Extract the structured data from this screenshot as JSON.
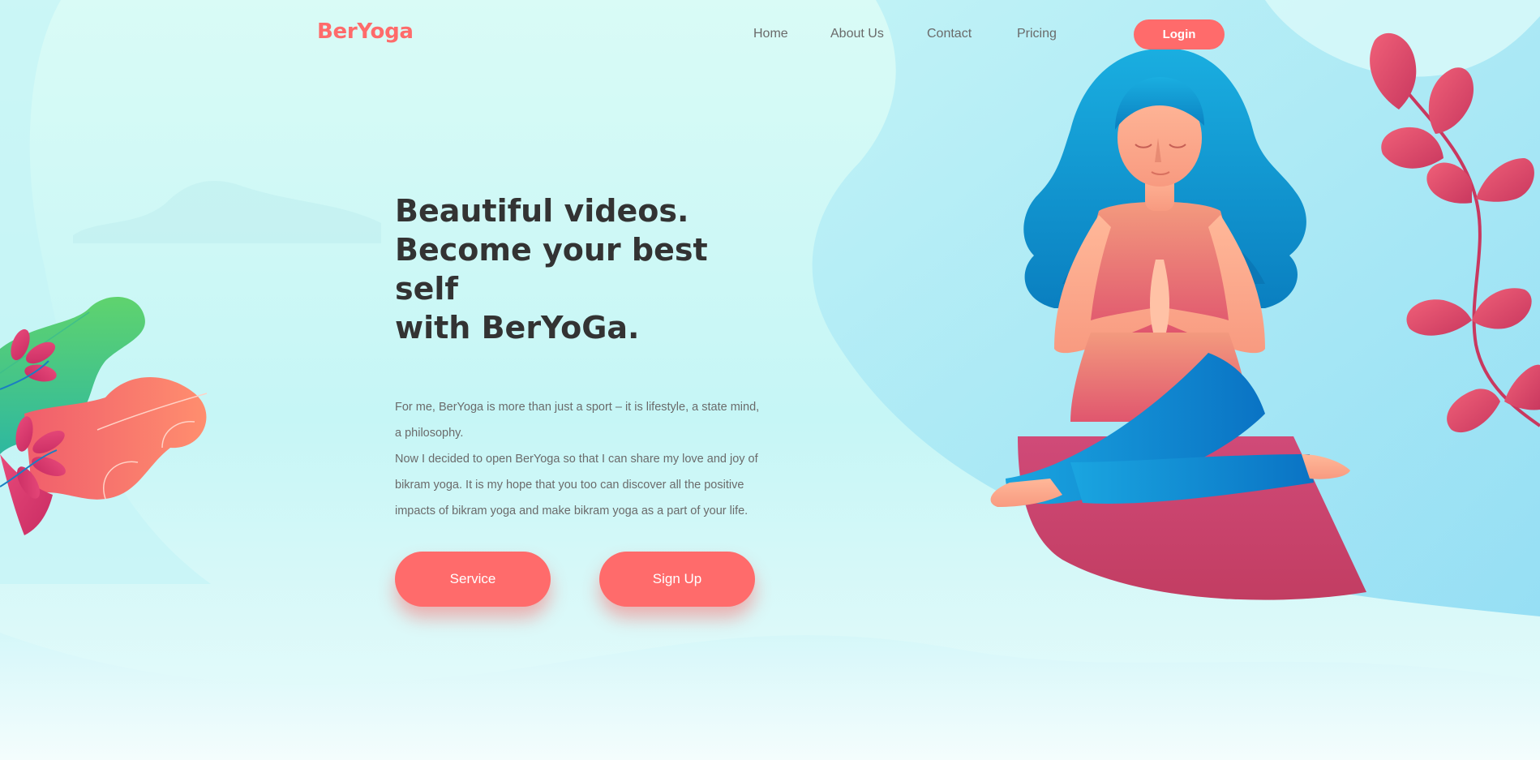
{
  "brand": {
    "name": "BerYoga",
    "color": "#ff6b6b"
  },
  "nav": {
    "links": [
      "Home",
      "About Us",
      "Contact",
      "Pricing"
    ],
    "login_label": "Login"
  },
  "hero": {
    "title_lines": [
      "Beautiful videos.",
      "Become your best self",
      "with BerYoGa."
    ],
    "paragraphs": [
      "For me, BerYoga is more than just a sport – it is lifestyle, a state mind, a philosophy.",
      "Now I decided to open BerYoga so that I can share my love and joy of bikram yoga. It is my hope that you too can discover all the positive impacts of bikram yoga and make bikram yoga as a part of your life."
    ],
    "service_label": "Service",
    "signup_label": "Sign Up"
  },
  "illustration": {
    "subject": "woman-meditating-icon",
    "plant_left": "leaf-plant-icon",
    "plant_right": "vine-icon"
  },
  "colors": {
    "accent": "#ff6b6b",
    "heading": "#333333",
    "body_text": "#6b6b6b",
    "hair": "#0a9bd8",
    "pants": "#1a8fd6",
    "mat": "#c94a72"
  }
}
